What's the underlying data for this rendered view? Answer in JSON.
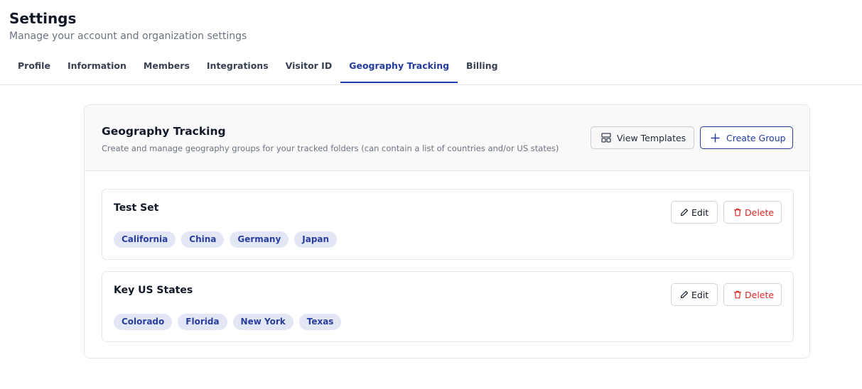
{
  "header": {
    "title": "Settings",
    "subtitle": "Manage your account and organization settings"
  },
  "tabs": [
    {
      "label": "Profile"
    },
    {
      "label": "Information"
    },
    {
      "label": "Members"
    },
    {
      "label": "Integrations"
    },
    {
      "label": "Visitor ID"
    },
    {
      "label": "Geography Tracking",
      "active": true
    },
    {
      "label": "Billing"
    }
  ],
  "panel": {
    "title": "Geography Tracking",
    "description": "Create and manage geography groups for your tracked folders (can contain a list of countries and/or US states)",
    "view_templates_label": "View Templates",
    "create_group_label": "Create Group"
  },
  "groups": [
    {
      "name": "Test Set",
      "tags": [
        "California",
        "China",
        "Germany",
        "Japan"
      ],
      "edit_label": "Edit",
      "delete_label": "Delete"
    },
    {
      "name": "Key US States",
      "tags": [
        "Colorado",
        "Florida",
        "New York",
        "Texas"
      ],
      "edit_label": "Edit",
      "delete_label": "Delete"
    }
  ],
  "colors": {
    "accent": "#233a9e",
    "tag_bg": "#e3e7f5",
    "danger": "#dc2626"
  }
}
